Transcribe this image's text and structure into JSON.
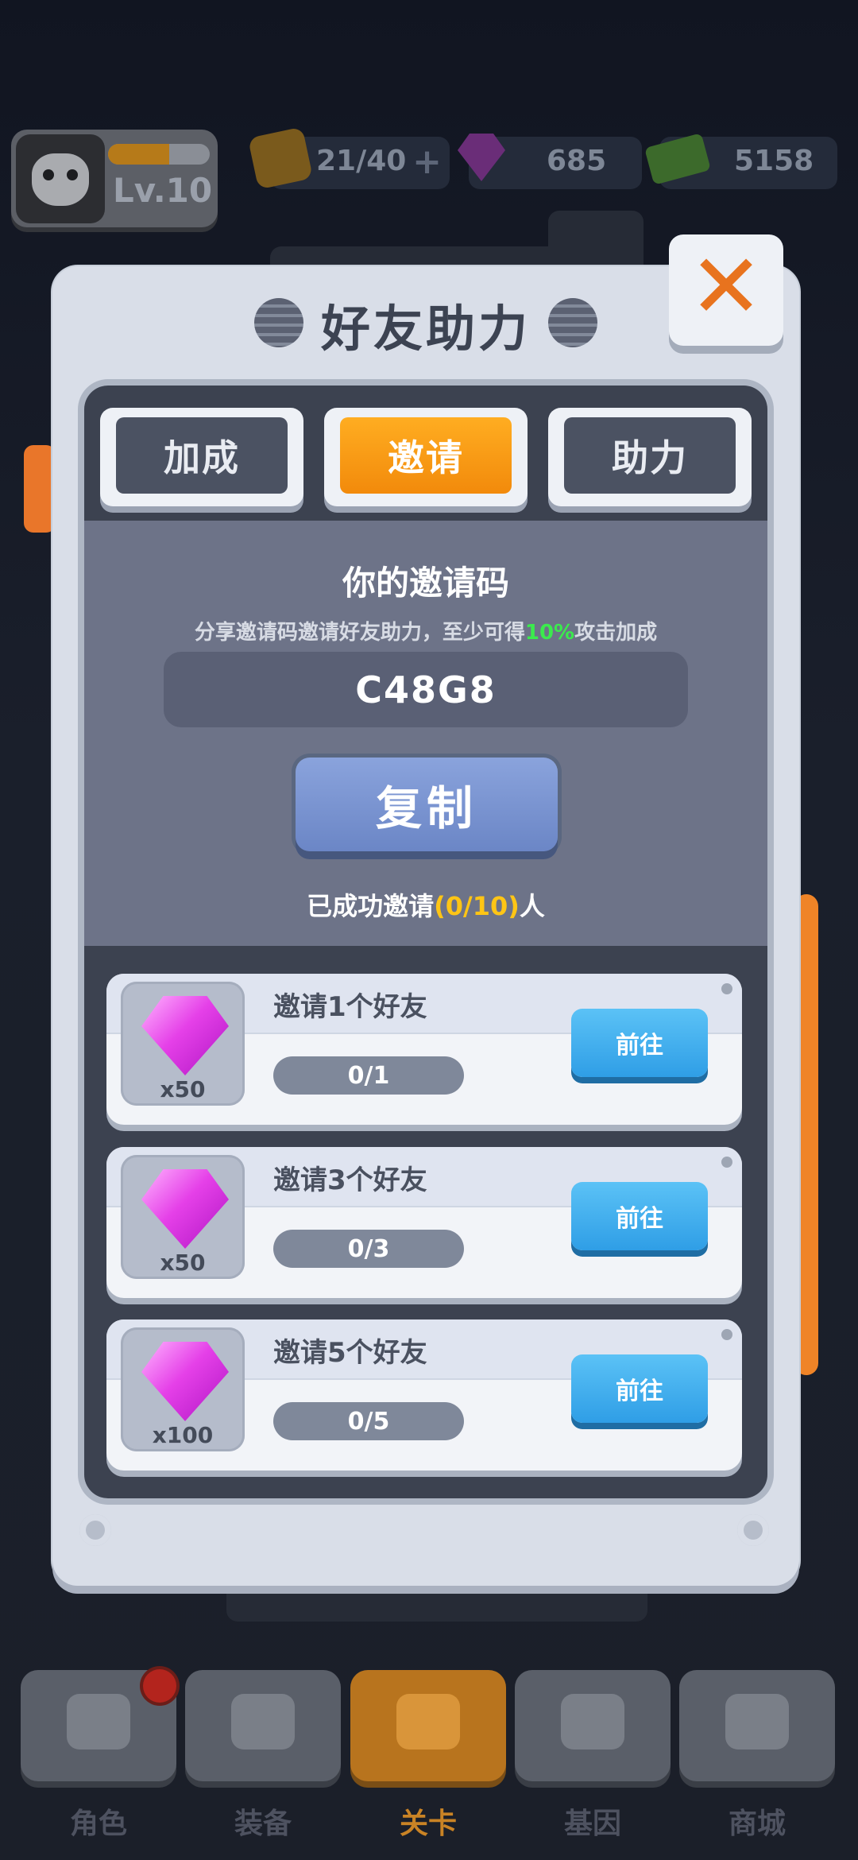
{
  "hud": {
    "level": "Lv.10",
    "xp_fraction": 0.6,
    "energy": "21/40",
    "gems": "685",
    "cash": "5158"
  },
  "modal": {
    "title": "好友助力",
    "close_icon": "close-icon",
    "tabs": [
      {
        "label": "加成",
        "active": false
      },
      {
        "label": "邀请",
        "active": true
      },
      {
        "label": "助力",
        "active": false
      }
    ],
    "invite": {
      "title": "你的邀请码",
      "desc_prefix": "分享邀请码邀请好友助力，至少可得",
      "desc_highlight": "10%",
      "desc_suffix": "攻击加成",
      "code": "C48G8",
      "copy_label": "复制",
      "success_prefix": "已成功邀请",
      "success_count": "(0/10)",
      "success_suffix": "人"
    },
    "rewards": [
      {
        "title": "邀请1个好友",
        "qty": "x50",
        "progress": "0/1",
        "button": "前往"
      },
      {
        "title": "邀请3个好友",
        "qty": "x50",
        "progress": "0/3",
        "button": "前往"
      },
      {
        "title": "邀请5个好友",
        "qty": "x100",
        "progress": "0/5",
        "button": "前往"
      }
    ]
  },
  "bottom_nav": [
    {
      "label": "角色",
      "icon": "skull-icon"
    },
    {
      "label": "装备",
      "icon": "gun-icon"
    },
    {
      "label": "关卡",
      "icon": "map-pin-icon",
      "active": true
    },
    {
      "label": "基因",
      "icon": "hexagon-icon"
    },
    {
      "label": "商城",
      "icon": "shop-icon"
    }
  ],
  "colors": {
    "accent_orange": "#f28a0b",
    "highlight_green": "#3bea4d",
    "highlight_yellow": "#ffc515",
    "button_blue": "#2f9ee6"
  }
}
